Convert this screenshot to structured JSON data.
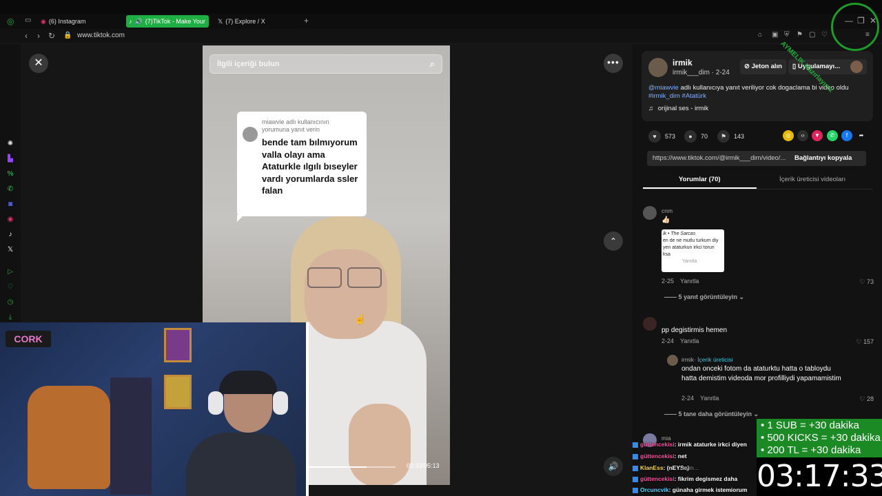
{
  "browser": {
    "tabs": [
      {
        "label": "(6) Instagram"
      },
      {
        "label": "(7)TikTok - Make Your"
      },
      {
        "label": "(7) Explore / X"
      }
    ],
    "url": "www.tiktok.com"
  },
  "video": {
    "search_placeholder": "İlgili içeriği bulun",
    "reply_header": "miawvie adlı kullanıcının yorumuna yanıt verin",
    "reply_text": "bende tam bılmıyorum valla olayı ama Ataturkle ılgılı bıseyler vardı yorumlarda ssler falan",
    "time": "03:33/05:13",
    "progress": 0.68
  },
  "creator": {
    "name": "irmik",
    "handle": "irmik___dim · 2-24",
    "jeton_button": "Jeton alın",
    "app_button": "Uygulamayı...",
    "desc_mention": "@miawvie",
    "desc_text": " adlı kullanıcıya yanıt veriliyor cok dogaclama bi video oldu ",
    "desc_tags": "#irmik_dim #Atatürk",
    "sound": "orijinal ses - irmik"
  },
  "stats": {
    "likes": "573",
    "comments": "70",
    "saves": "143"
  },
  "link": {
    "url": "https://www.tiktok.com/@irmik___dim/video/...",
    "copy_button": "Bağlantıyı kopyala"
  },
  "panel_tabs": {
    "comments": "Yorumlar (70)",
    "creator_videos": "İçerik üreticisi videoları"
  },
  "comments": [
    {
      "user": "cnm",
      "text": "👍🏻",
      "date": "2-25",
      "reply": "Yanıtla",
      "likes": "73",
      "more": "5 yanıt görüntüleyin",
      "thumb_lines": [
        "ik • The Sarcas",
        "en de ne mutlu turkum diy",
        "yen ataturkun irkci torun",
        "ksa",
        "Yanıtla"
      ]
    },
    {
      "user": "",
      "text": "pp degistirmis hemen",
      "date": "2-24",
      "reply": "Yanıtla",
      "likes": "157"
    },
    {
      "user": "irmik",
      "creator_badge": "· İçerik üreticisi",
      "text": "ondan onceki fotom da ataturktu hatta o tabloydu hatta demistim videoda mor profilliydi yapamamistim",
      "date": "2-24",
      "reply": "Yanıtla",
      "likes": "28",
      "more": "5 tane daha görüntüleyin"
    },
    {
      "user": "mia"
    }
  ],
  "chat": [
    {
      "user": "güttencekisi",
      "msg": ": irmik ataturke irkci diyen"
    },
    {
      "user": "güttencekisi",
      "msg": ": net"
    },
    {
      "user": "KlanEss",
      "msg": ": (nEYSe)"
    },
    {
      "user": "güttencekisi",
      "msg": ": fikrim degismez daha"
    },
    {
      "user": "Orcuncvik",
      "msg": ": günaha girmek istemiorum"
    }
  ],
  "chat_input_placeholder": "...eyin...",
  "subathon": {
    "lines": [
      "• 1 SUB = +30 dakika",
      "• 500 KICKS = +30 dakika",
      "• 200 TL = +30 dakika"
    ],
    "timer": "03:17:33"
  },
  "cam_logo": "CORK",
  "watermark": "AYMELIK Hazırlayınız",
  "colors": {
    "accent_green": "#1fae43",
    "link_blue": "#7fb2ff",
    "chat_user": "#ff4fa0",
    "subathon_bg": "#1c8a24"
  }
}
